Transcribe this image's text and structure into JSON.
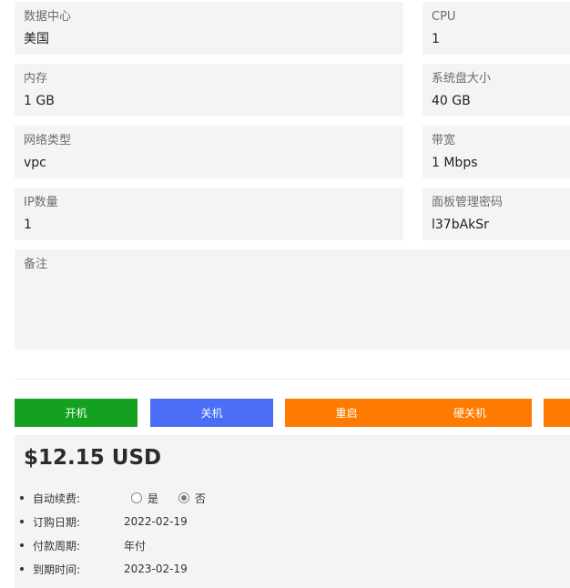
{
  "specs": [
    {
      "label": "数据中心",
      "value": "美国"
    },
    {
      "label": "CPU",
      "value": "1"
    },
    {
      "label": "内存",
      "value": "1 GB"
    },
    {
      "label": "系统盘大小",
      "value": "40 GB"
    },
    {
      "label": "网络类型",
      "value": "vpc"
    },
    {
      "label": "带宽",
      "value": "1 Mbps"
    },
    {
      "label": "IP数量",
      "value": "1"
    },
    {
      "label": "面板管理密码",
      "value": "l37bAkSr"
    }
  ],
  "remark": {
    "label": "备注",
    "value": ""
  },
  "actions": {
    "power_on": "开机",
    "power_off": "关机",
    "restart": "重启",
    "hard_shutdown": "硬关机"
  },
  "colors": {
    "power_on": "#13a11f",
    "power_off": "#4a6ef5",
    "restart": "#ff7a00",
    "card_bg": "#f4f4f6"
  },
  "billing": {
    "price": "$12.15 USD",
    "auto_renew_label": "自动续费:",
    "auto_renew_yes": "是",
    "auto_renew_no": "否",
    "auto_renew_selected": "否",
    "order_date_label": "订购日期:",
    "order_date": "2022-02-19",
    "payment_cycle_label": "付款周期:",
    "payment_cycle": "年付",
    "expiry_label": "到期时间:",
    "expiry_date": "2023-02-19"
  }
}
